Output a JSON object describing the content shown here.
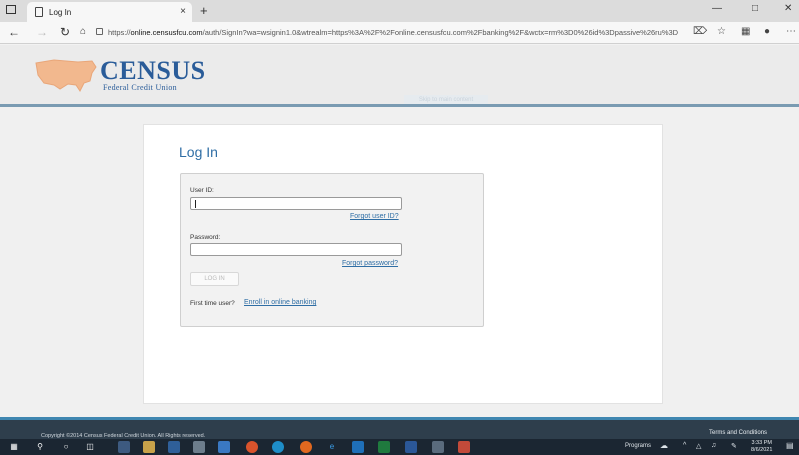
{
  "browser": {
    "tab_title": "Log In",
    "tab_close": "×",
    "new_tab": "+",
    "url_prefix": "https://",
    "url_host": "online.censusfcu.com",
    "url_path": "/auth/SignIn?wa=wsignin1.0&wtrealm=https%3A%2F%2Fonline.censusfcu.com%2Fbanking%2F&wctx=rm%3D0%26id%3Dpassive%26ru%3D...",
    "icons": [
      "tab-actions-icon",
      "back-icon",
      "forward-icon",
      "refresh-icon",
      "home-icon",
      "lock-icon",
      "read-aloud-icon",
      "favorites-icon",
      "collections-icon",
      "profile-icon",
      "more-icon",
      "minimize-icon",
      "maximize-icon",
      "close-icon"
    ]
  },
  "site": {
    "logo_name": "CENSUS",
    "logo_sub": "Federal Credit Union",
    "skip_link": "Skip to main content",
    "brand_color": "#2a5c99",
    "accent_color": "#3f86b0"
  },
  "login": {
    "title": "Log In",
    "user_id_label": "User ID:",
    "user_id_value": "",
    "forgot_user_id": "Forgot user ID?",
    "password_label": "Password:",
    "password_value": "",
    "forgot_password": "Forgot password?",
    "login_button": "LOG IN",
    "first_time_text": "First time user?",
    "enroll_link": "Enroll in online banking"
  },
  "footer": {
    "copyright": "Copyright ©2014 Census Federal Credit Union. All Rights reserved.",
    "terms": "Terms and Conditions"
  },
  "taskbar": {
    "programs_label": "Programs",
    "time": "3:33 PM",
    "date": "8/6/2021"
  }
}
